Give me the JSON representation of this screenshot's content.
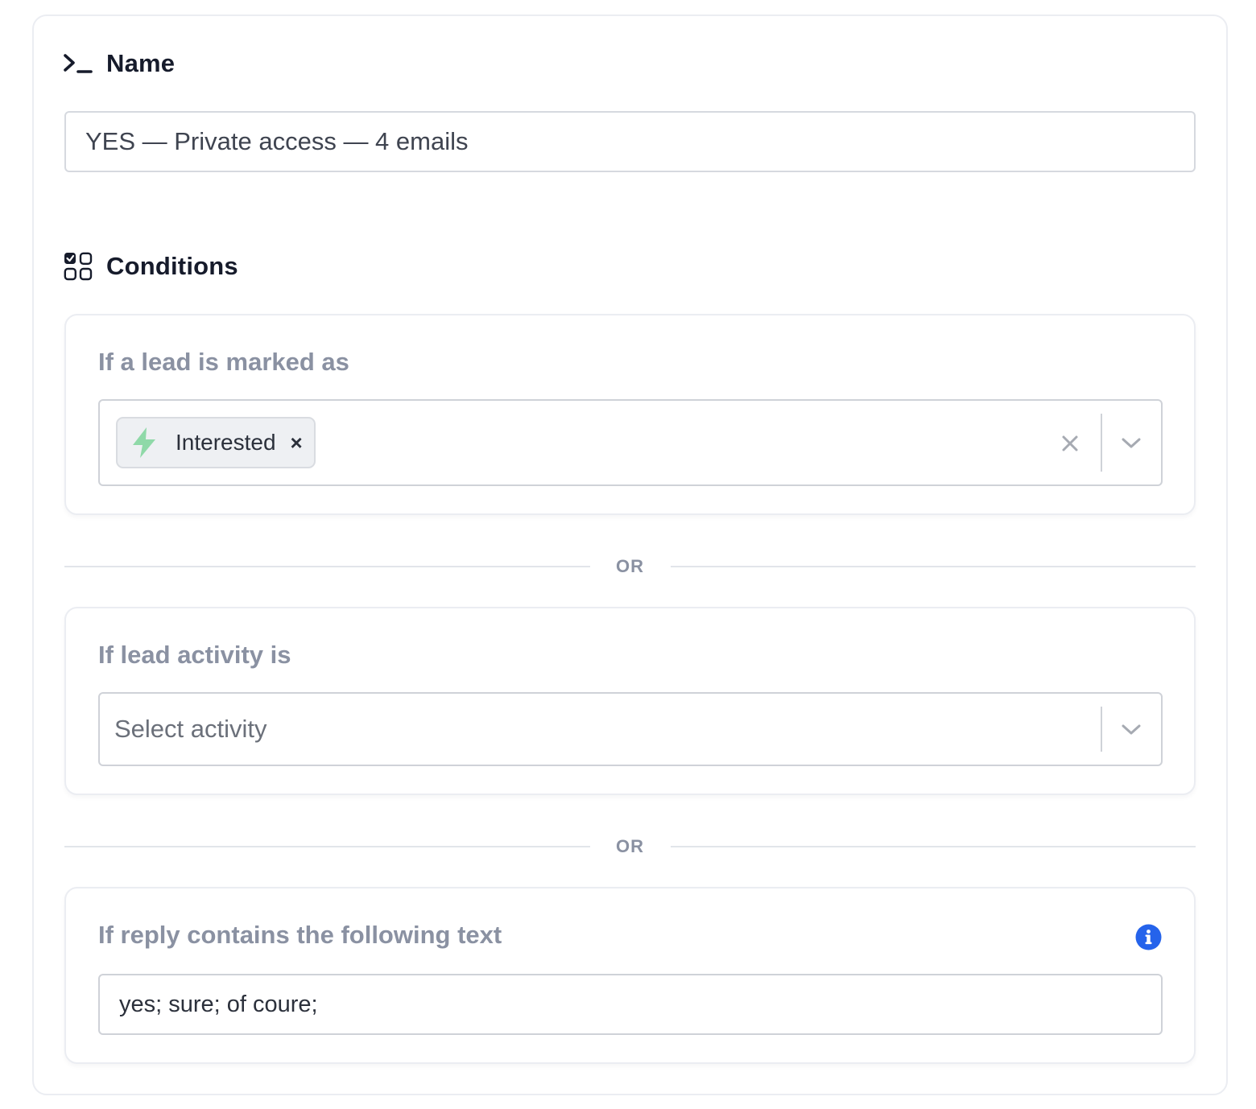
{
  "name_section": {
    "title": "Name",
    "icon": "terminal-prompt-icon",
    "input_value": "YES — Private access — 4 emails"
  },
  "conditions_section": {
    "title": "Conditions",
    "icon": "checklist-grid-icon"
  },
  "lead_status_condition": {
    "label": "If a lead is marked as",
    "selected_tags": [
      {
        "label": "Interested",
        "icon": "lightning-bolt-icon",
        "icon_color": "#8fd9a8"
      }
    ]
  },
  "separator_1": {
    "text": "OR"
  },
  "lead_activity_condition": {
    "label": "If lead activity is",
    "placeholder": "Select activity"
  },
  "separator_2": {
    "text": "OR"
  },
  "reply_text_condition": {
    "label": "If reply contains the following text",
    "value": "yes; sure; of coure;",
    "info_icon_color": "#2563eb"
  }
}
